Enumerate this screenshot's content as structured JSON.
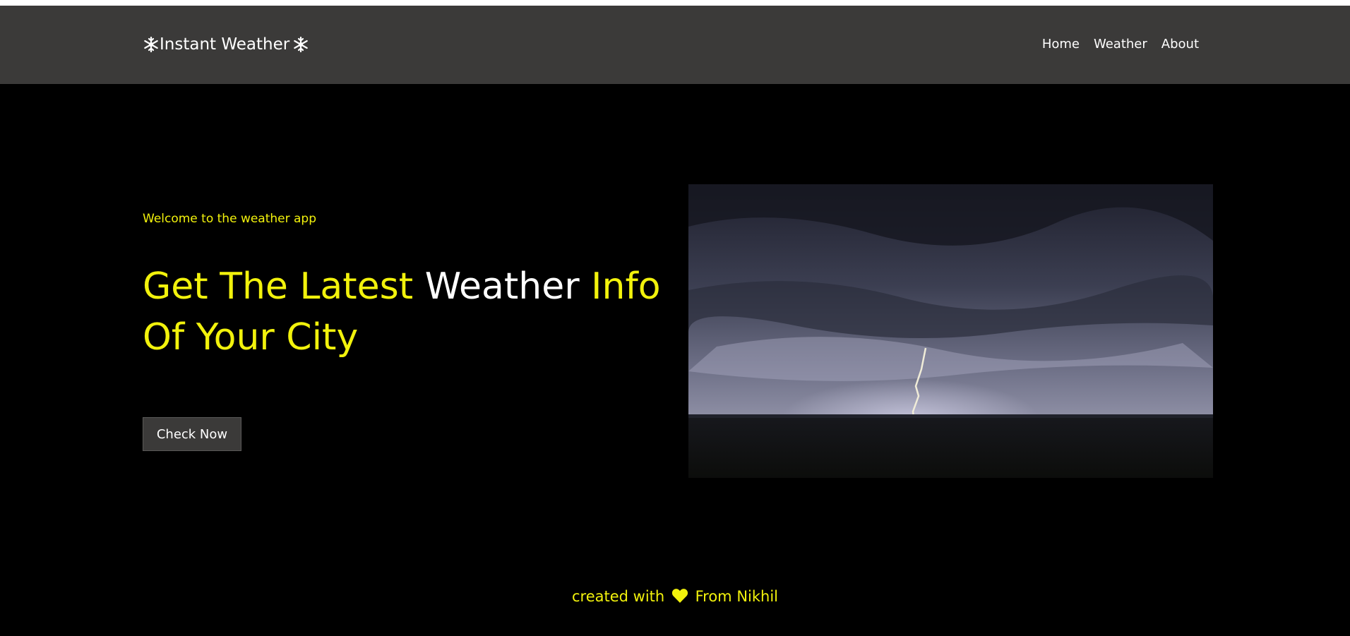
{
  "app": {
    "brand_text": "Instant Weather",
    "brand_icon": "snowflake-icon"
  },
  "nav": {
    "items": [
      {
        "label": "Home"
      },
      {
        "label": "Weather"
      },
      {
        "label": "About"
      }
    ]
  },
  "hero": {
    "welcome": "Welcome to the weather app",
    "headline_part1": "Get The Latest ",
    "headline_part2": "Weather",
    "headline_part3": " Info Of Your City",
    "button_label": "Check Now",
    "image_alt": "storm clouds with lightning"
  },
  "footer": {
    "text_before": "created with",
    "heart_icon": "heart-icon",
    "text_after": "From Nikhil"
  },
  "colors": {
    "accent": "#f2f20c",
    "navbar_bg": "#3b3a39",
    "page_bg": "#000000",
    "text": "#ffffff"
  }
}
